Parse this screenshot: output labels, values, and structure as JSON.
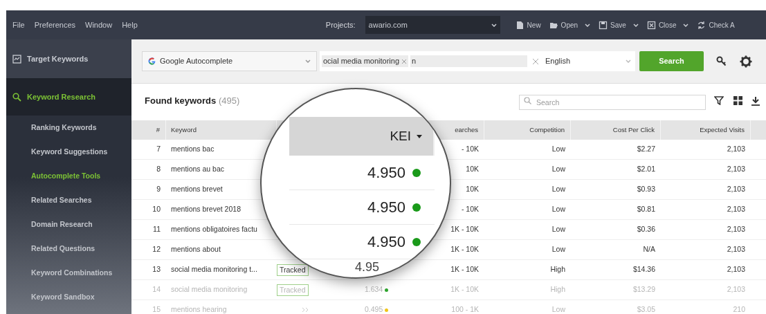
{
  "menu": [
    "File",
    "Preferences",
    "Window",
    "Help"
  ],
  "project": {
    "label": "Projects:",
    "value": "awario.com"
  },
  "toolbar": [
    {
      "label": "New",
      "kind": "new",
      "dropdown": false
    },
    {
      "label": "Open",
      "kind": "open",
      "dropdown": true
    },
    {
      "label": "Save",
      "kind": "save",
      "dropdown": true
    },
    {
      "label": "Close",
      "kind": "close",
      "dropdown": true
    },
    {
      "label": "Check A",
      "kind": "check",
      "dropdown": false
    }
  ],
  "sidebar": [
    {
      "label": "Target Keywords",
      "kind": "chart",
      "selected": false
    },
    {
      "label": "Keyword Research",
      "kind": "search",
      "selected": true,
      "children": [
        {
          "label": "Ranking Keywords",
          "selected": false
        },
        {
          "label": "Keyword Suggestions",
          "selected": false
        },
        {
          "label": "Autocomplete Tools",
          "selected": true
        },
        {
          "label": "Related Searches",
          "selected": false
        },
        {
          "label": "Domain Research",
          "selected": false
        },
        {
          "label": "Related Questions",
          "selected": false
        },
        {
          "label": "Keyword Combinations",
          "selected": false
        },
        {
          "label": "Keyword Sandbox",
          "selected": false
        }
      ]
    }
  ],
  "search_bar": {
    "source": "Google Autocomplete",
    "tags": [
      "ocial media monitoring"
    ],
    "query": "n",
    "language": "English",
    "button": "Search"
  },
  "results": {
    "title": "Found keywords",
    "count": "(495)",
    "search": {
      "placeholder": "Search"
    }
  },
  "table": {
    "columns": [
      "#",
      "Keyword",
      "earches",
      "Competition",
      "Cost Per Click",
      "Expected Visits"
    ],
    "rows": [
      {
        "num": "7",
        "keyword": "mentions bac",
        "tracked": false,
        "searches": "- 10K",
        "competition": "Low",
        "cpc": "$2.27",
        "visits": "2,103",
        "faded": false
      },
      {
        "num": "8",
        "keyword": "mentions au bac",
        "tracked": false,
        "searches": "10K",
        "competition": "Low",
        "cpc": "$2.01",
        "visits": "2,103",
        "faded": false
      },
      {
        "num": "9",
        "keyword": "mentions brevet",
        "tracked": false,
        "searches": "10K",
        "competition": "Low",
        "cpc": "$0.93",
        "visits": "2,103",
        "faded": false
      },
      {
        "num": "10",
        "keyword": "mentions brevet 2018",
        "tracked": false,
        "searches": "- 10K",
        "competition": "Low",
        "cpc": "$0.81",
        "visits": "2,103",
        "faded": false
      },
      {
        "num": "11",
        "keyword": "mentions obligatoires factu",
        "tracked": false,
        "searches": "1K - 10K",
        "competition": "Low",
        "cpc": "$0.36",
        "visits": "2,103",
        "faded": false
      },
      {
        "num": "12",
        "keyword": "mentions about",
        "tracked": false,
        "searches": "1K - 10K",
        "competition": "Low",
        "cpc": "N/A",
        "visits": "2,103",
        "faded": false
      },
      {
        "num": "13",
        "keyword": "social media monitoring t...",
        "tracked": true,
        "tag": "Tracked",
        "searches": "1K - 10K",
        "competition": "High",
        "cpc": "$14.36",
        "visits": "2,103",
        "faded": false
      },
      {
        "num": "14",
        "keyword": "social media monitoring",
        "tracked": true,
        "tag": "Tracked",
        "kei": "1.634",
        "color": "#2ea52e",
        "searches": "1K - 10K",
        "competition": "High",
        "cpc": "$13.29",
        "visits": "2,103",
        "faded": true
      },
      {
        "num": "15",
        "keyword": "mentions hearing",
        "tracked": false,
        "expand": true,
        "kei": "0.495",
        "color": "#f0c419",
        "searches": "100 - 1K",
        "competition": "Low",
        "cpc": "$3.05",
        "visits": "210",
        "faded": true
      }
    ]
  },
  "magnifier": {
    "header": "KEI",
    "values": [
      {
        "value": "4.950",
        "color": "#1a9a1a"
      },
      {
        "value": "4.950",
        "color": "#1a9a1a"
      },
      {
        "value": "4.950",
        "color": "#1a9a1a"
      },
      {
        "value": "4.95"
      }
    ]
  }
}
